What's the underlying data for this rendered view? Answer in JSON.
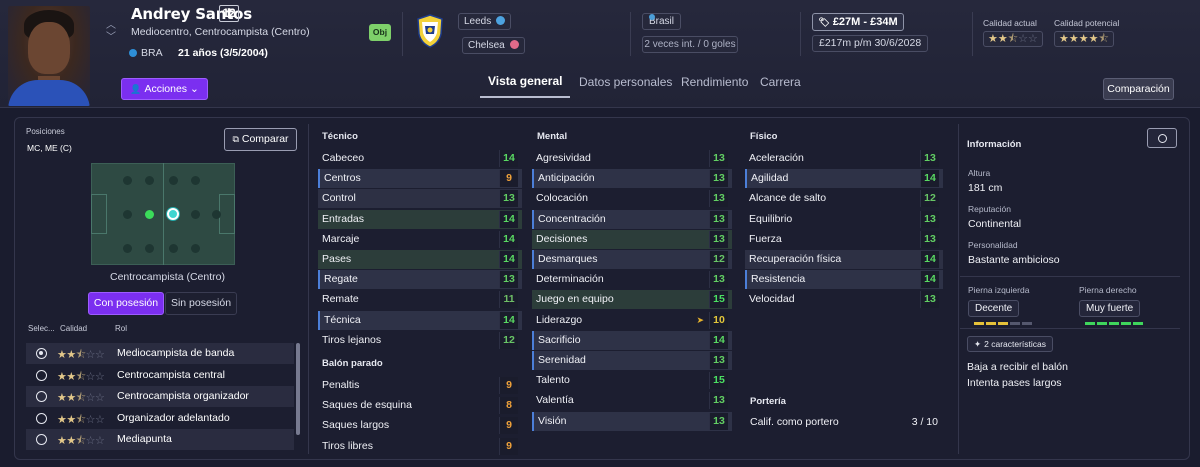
{
  "player": {
    "name": "Andrey Santos",
    "number": "12",
    "positions": "Mediocentro, Centrocampista (Centro)",
    "nationality": "BRA",
    "age": "21 años (3/5/2004)",
    "actions_label": "Acciones",
    "objective_badge": "Obj",
    "clubs": [
      {
        "name": "Leeds",
        "icon": "loan-icon",
        "color": "#4da3e0"
      },
      {
        "name": "Chelsea",
        "icon": "parent-club-icon",
        "color": "#e06a8a"
      }
    ],
    "country": "Brasil",
    "caps": "2 veces int. / 0 goles",
    "value": "£27M - £34M",
    "wage_contract": "£217m p/m 30/6/2028",
    "current_quality_label": "Calidad actual",
    "potential_quality_label": "Calidad potencial",
    "current_stars": 2.5,
    "potential_stars": 4.5
  },
  "tabs": [
    "Vista general",
    "Datos personales",
    "Rendimiento",
    "Carrera"
  ],
  "compare_button": "Comparación",
  "left_panel": {
    "positions_label": "Posiciones",
    "positions_value": "MC, ME (C)",
    "compare_button": "Comparar",
    "pitch_caption": "Centrocampista (Centro)",
    "segment_on": "Con posesión",
    "segment_off": "Sin posesión",
    "role_headers": [
      "Selec...",
      "Calidad",
      "Rol"
    ],
    "roles": [
      {
        "name": "Mediocampista de banda",
        "stars": 2.5,
        "selected": true
      },
      {
        "name": "Centrocampista central",
        "stars": 2.5,
        "selected": false
      },
      {
        "name": "Centrocampista organizador",
        "stars": 2.5,
        "selected": false
      },
      {
        "name": "Organizador adelantado",
        "stars": 2.5,
        "selected": false
      },
      {
        "name": "Mediapunta",
        "stars": 2.5,
        "selected": false
      }
    ]
  },
  "attributes": {
    "tecnico": {
      "title": "Técnico",
      "items": [
        {
          "name": "Cabeceo",
          "value": 14,
          "style": ""
        },
        {
          "name": "Centros",
          "value": 9,
          "style": "blue"
        },
        {
          "name": "Control",
          "value": 13,
          "style": "hl"
        },
        {
          "name": "Entradas",
          "value": 14,
          "style": "green"
        },
        {
          "name": "Marcaje",
          "value": 14,
          "style": ""
        },
        {
          "name": "Pases",
          "value": 14,
          "style": "green"
        },
        {
          "name": "Regate",
          "value": 13,
          "style": "blue"
        },
        {
          "name": "Remate",
          "value": 11,
          "style": ""
        },
        {
          "name": "Técnica",
          "value": 14,
          "style": "blue"
        },
        {
          "name": "Tiros lejanos",
          "value": 12,
          "style": ""
        }
      ]
    },
    "balon_parado": {
      "title": "Balón parado",
      "items": [
        {
          "name": "Penaltis",
          "value": 9,
          "style": ""
        },
        {
          "name": "Saques de esquina",
          "value": 8,
          "style": ""
        },
        {
          "name": "Saques largos",
          "value": 9,
          "style": ""
        },
        {
          "name": "Tiros libres",
          "value": 9,
          "style": ""
        }
      ]
    },
    "mental": {
      "title": "Mental",
      "items": [
        {
          "name": "Agresividad",
          "value": 13,
          "style": ""
        },
        {
          "name": "Anticipación",
          "value": 13,
          "style": "blue"
        },
        {
          "name": "Colocación",
          "value": 13,
          "style": ""
        },
        {
          "name": "Concentración",
          "value": 13,
          "style": "blue"
        },
        {
          "name": "Decisiones",
          "value": 13,
          "style": "green"
        },
        {
          "name": "Desmarques",
          "value": 12,
          "style": "blue"
        },
        {
          "name": "Determinación",
          "value": 13,
          "style": ""
        },
        {
          "name": "Juego en equipo",
          "value": 15,
          "style": "green"
        },
        {
          "name": "Liderazgo",
          "value": 10,
          "style": "",
          "flag": true
        },
        {
          "name": "Sacrificio",
          "value": 14,
          "style": "blue"
        },
        {
          "name": "Serenidad",
          "value": 13,
          "style": "blue"
        },
        {
          "name": "Talento",
          "value": 15,
          "style": ""
        },
        {
          "name": "Valentía",
          "value": 13,
          "style": ""
        },
        {
          "name": "Visión",
          "value": 13,
          "style": "blue"
        }
      ]
    },
    "fisico": {
      "title": "Físico",
      "items": [
        {
          "name": "Aceleración",
          "value": 13,
          "style": ""
        },
        {
          "name": "Agilidad",
          "value": 14,
          "style": "blue"
        },
        {
          "name": "Alcance de salto",
          "value": 12,
          "style": ""
        },
        {
          "name": "Equilibrio",
          "value": 13,
          "style": ""
        },
        {
          "name": "Fuerza",
          "value": 13,
          "style": ""
        },
        {
          "name": "Recuperación física",
          "value": 14,
          "style": "hl"
        },
        {
          "name": "Resistencia",
          "value": 14,
          "style": "blue"
        },
        {
          "name": "Velocidad",
          "value": 13,
          "style": ""
        }
      ]
    },
    "porteria": {
      "title": "Portería",
      "label": "Calif. como portero",
      "value": "3 / 10"
    }
  },
  "info": {
    "title": "Información",
    "height_label": "Altura",
    "height": "181 cm",
    "reputation_label": "Reputación",
    "reputation": "Continental",
    "personality_label": "Personalidad",
    "personality": "Bastante ambicioso",
    "left_foot_label": "Pierna izquierda",
    "left_foot": "Decente",
    "right_foot_label": "Pierna derecho",
    "right_foot": "Muy fuerte",
    "characteristics_button": "2 características",
    "traits": [
      "Baja a recibir el balón",
      "Intenta pases largos"
    ]
  }
}
